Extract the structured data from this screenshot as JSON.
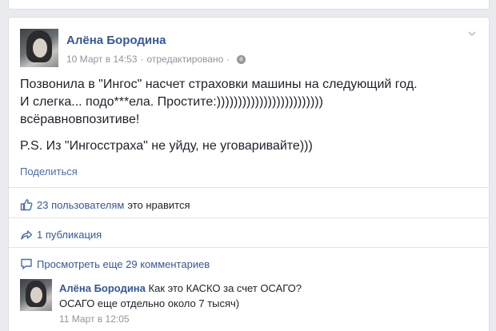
{
  "post": {
    "author": "Алёна Бородина",
    "date": "10 Март в 14:53",
    "separator": "·",
    "edited": "отредактировано",
    "separator2": "·",
    "privacy_icon": "globe-icon",
    "menu_icon": "chevron-down-icon",
    "text_lines": [
      "Позвонила в \"Ингос\" насчет страховки машины на следующий год.",
      "И слегка... подо***ела. Простите:)))))))))))))))))))))))))",
      "всёравновпозитиве!"
    ],
    "ps": "P.S. Из \"Ингосстраха\" не уйду, не уговаривайте)))",
    "share_label": "Поделиться"
  },
  "likes": {
    "icon": "thumbs-up-icon",
    "count_label": "23 пользователям",
    "suffix": "это нравится"
  },
  "shares": {
    "icon": "share-arrow-icon",
    "label": "1 публикация"
  },
  "comments": {
    "icon": "comment-bubble-icon",
    "view_more_label": "Просмотреть еще 29 комментариев",
    "items": [
      {
        "author": "Алёна Бородина",
        "text_line1": "Как это КАСКО за счет ОСАГО?",
        "text_line2": "ОСАГО еще отдельно около 7 тысяч)",
        "time": "11 Март в 12:05"
      }
    ]
  },
  "colors": {
    "link": "#365899",
    "meta": "#90949c",
    "background": "#e9ebee"
  }
}
